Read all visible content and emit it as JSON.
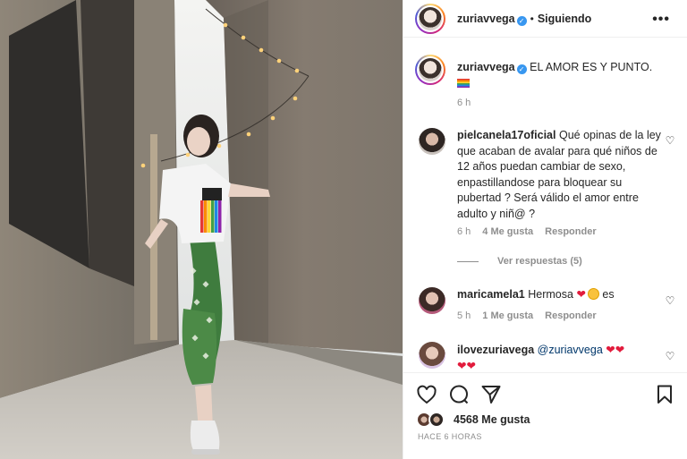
{
  "post": {
    "username": "zuriavvega",
    "follow_state": "Siguiendo",
    "more_label": "•••",
    "caption": "EL AMOR ES Y PUNTO.",
    "caption_emoji": "rainbow-flag",
    "caption_time": "6 h"
  },
  "comments": [
    {
      "username": "pielcanela17oficial",
      "text": "Qué opinas de la ley que acaban de avalar para qué niños de 12 años puedan cambiar de sexo, enpastillandose para bloquear su pubertad ? Será válido el amor entre adulto y niñ@ ?",
      "time": "6 h",
      "likes": "4 Me gusta",
      "reply": "Responder",
      "view_replies": "Ver respuestas (5)"
    },
    {
      "username": "maricamela1",
      "text": "Hermosa",
      "suffix": "es",
      "time": "5 h",
      "likes": "1 Me gusta",
      "reply": "Responder"
    },
    {
      "username": "ilovezuriavega",
      "mention": "@zuriavvega"
    }
  ],
  "footer": {
    "likes": "4568 Me gusta",
    "timestamp": "HACE 6 HORAS"
  },
  "colors": {
    "verified": "#3897f0",
    "heart_red": "#e21b3c",
    "muted": "#8e8e8e"
  }
}
